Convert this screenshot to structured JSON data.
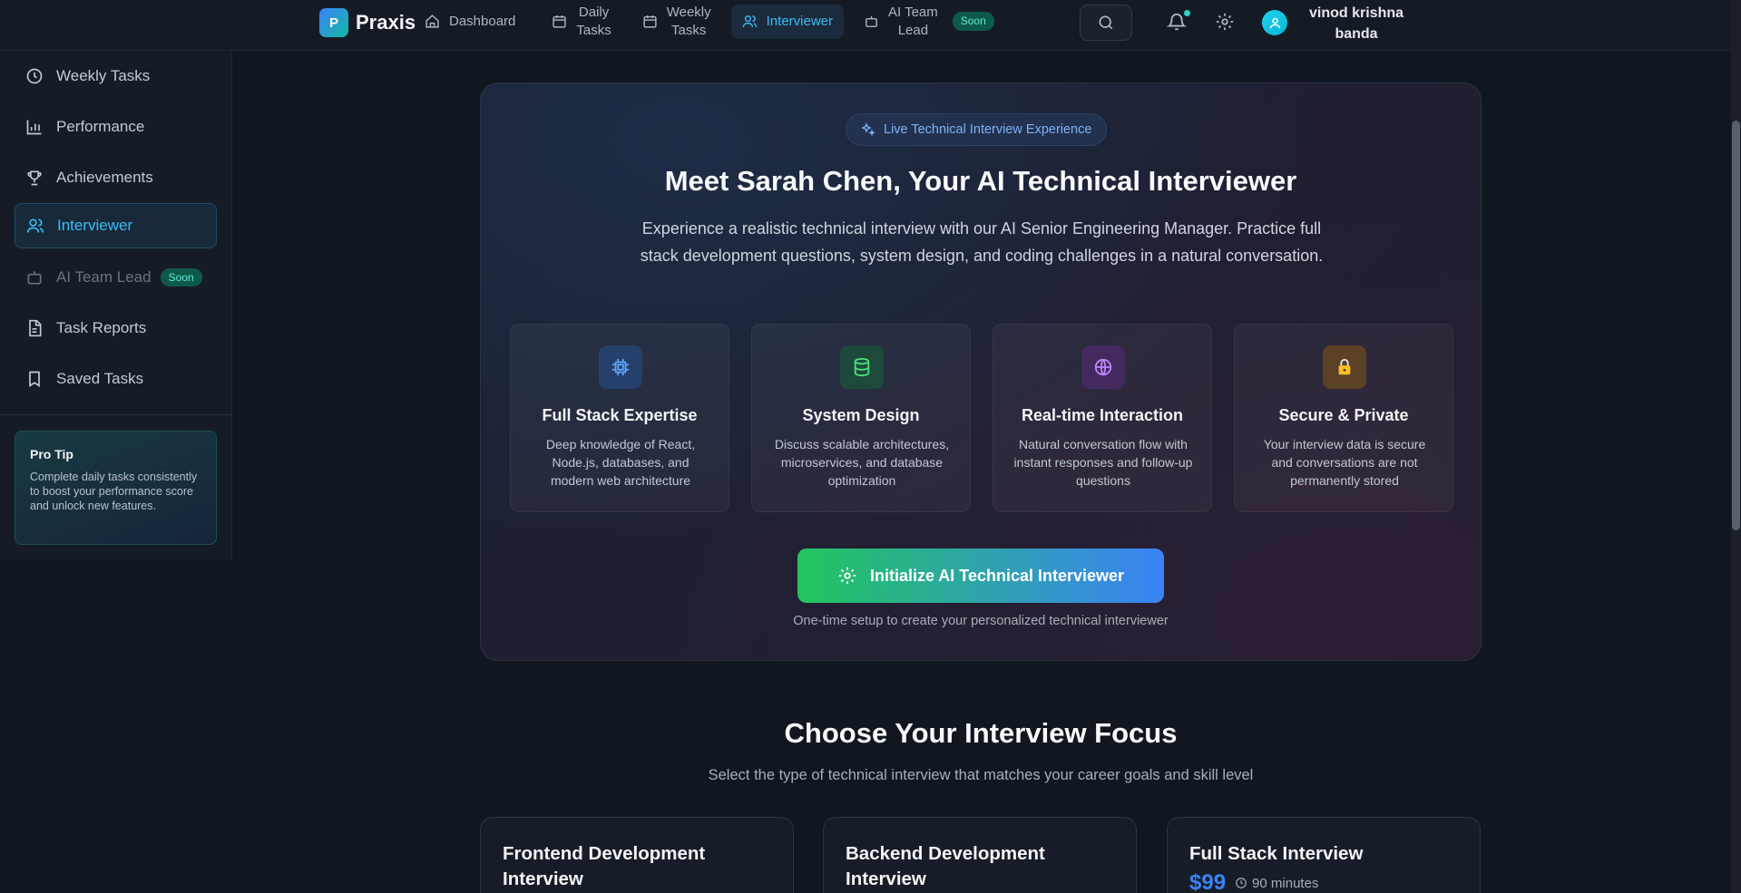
{
  "header": {
    "logo_letter": "P",
    "brand": "Praxis",
    "nav": [
      {
        "label": "Dashboard",
        "icon": "home-icon"
      },
      {
        "label": "Daily\nTasks",
        "icon": "calendar-icon"
      },
      {
        "label": "Weekly\nTasks",
        "icon": "calendar-icon"
      },
      {
        "label": "Interviewer",
        "icon": "users-icon",
        "active": true
      },
      {
        "label": "AI Team\nLead",
        "icon": "bot-icon",
        "badge": "Soon"
      }
    ],
    "user_name": "vinod krishna banda"
  },
  "sidebar": {
    "items": [
      {
        "label": "Weekly Tasks",
        "icon": "clock-icon"
      },
      {
        "label": "Performance",
        "icon": "bar-chart-icon"
      },
      {
        "label": "Achievements",
        "icon": "trophy-icon"
      },
      {
        "label": "Interviewer",
        "icon": "users-icon",
        "active": true
      },
      {
        "label": "AI Team Lead",
        "icon": "bot-icon",
        "badge": "Soon"
      },
      {
        "label": "Task Reports",
        "icon": "file-text-icon"
      },
      {
        "label": "Saved Tasks",
        "icon": "bookmark-icon"
      }
    ],
    "pro_tip": {
      "title": "Pro Tip",
      "text": "Complete daily tasks consistently to boost your performance score and unlock new features."
    }
  },
  "hero": {
    "badge": "Live Technical Interview Experience",
    "title": "Meet Sarah Chen, Your AI Technical Interviewer",
    "description": "Experience a realistic technical interview with our AI Senior Engineering Manager. Practice full stack development questions, system design, and coding challenges in a natural conversation.",
    "features": [
      {
        "title": "Full Stack Expertise",
        "desc": "Deep knowledge of React, Node.js, databases, and modern web architecture",
        "icon": "cpu-icon",
        "color": "#60a5fa"
      },
      {
        "title": "System Design",
        "desc": "Discuss scalable architectures, microservices, and database optimization",
        "icon": "database-icon",
        "color": "#4ade80"
      },
      {
        "title": "Real-time Interaction",
        "desc": "Natural conversation flow with instant responses and follow-up questions",
        "icon": "globe-icon",
        "color": "#c084fc"
      },
      {
        "title": "Secure & Private",
        "desc": "Your interview data is secure and conversations are not permanently stored",
        "icon": "lock-icon",
        "color": "#fbbf24"
      }
    ],
    "button_label": "Initialize AI Technical Interviewer",
    "button_note": "One-time setup to create your personalized technical interviewer"
  },
  "focus": {
    "title": "Choose Your Interview Focus",
    "subtitle": "Select the type of technical interview that matches your career goals and skill level",
    "cards": [
      {
        "title": "Frontend Development Interview"
      },
      {
        "title": "Backend Development Interview"
      },
      {
        "title": "Full Stack Interview",
        "price": "$99",
        "duration": "90 minutes"
      }
    ]
  }
}
